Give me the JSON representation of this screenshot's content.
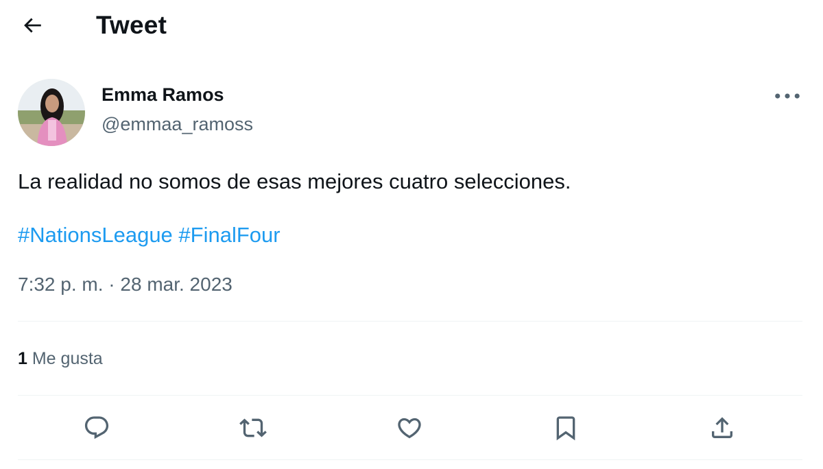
{
  "header": {
    "back_icon": "arrow-left-icon",
    "title": "Tweet"
  },
  "author": {
    "name": "Emma Ramos",
    "handle": "@emmaa_ramoss",
    "more_icon": "more-horizontal-icon"
  },
  "tweet": {
    "text": "La realidad no somos de esas mejores cuatro selecciones.",
    "hashtags": [
      "#NationsLeague",
      "#FinalFour"
    ],
    "timestamp": "7:32 p. m. · 28 mar. 2023"
  },
  "stats": {
    "likes_count": "1",
    "likes_label": "Me gusta"
  },
  "actions": [
    {
      "icon": "reply-icon"
    },
    {
      "icon": "retweet-icon"
    },
    {
      "icon": "like-icon"
    },
    {
      "icon": "bookmark-icon"
    },
    {
      "icon": "share-icon"
    }
  ],
  "colors": {
    "text_primary": "#0f1419",
    "text_secondary": "#536471",
    "link": "#1d9bf0",
    "divider": "#eff3f4"
  }
}
